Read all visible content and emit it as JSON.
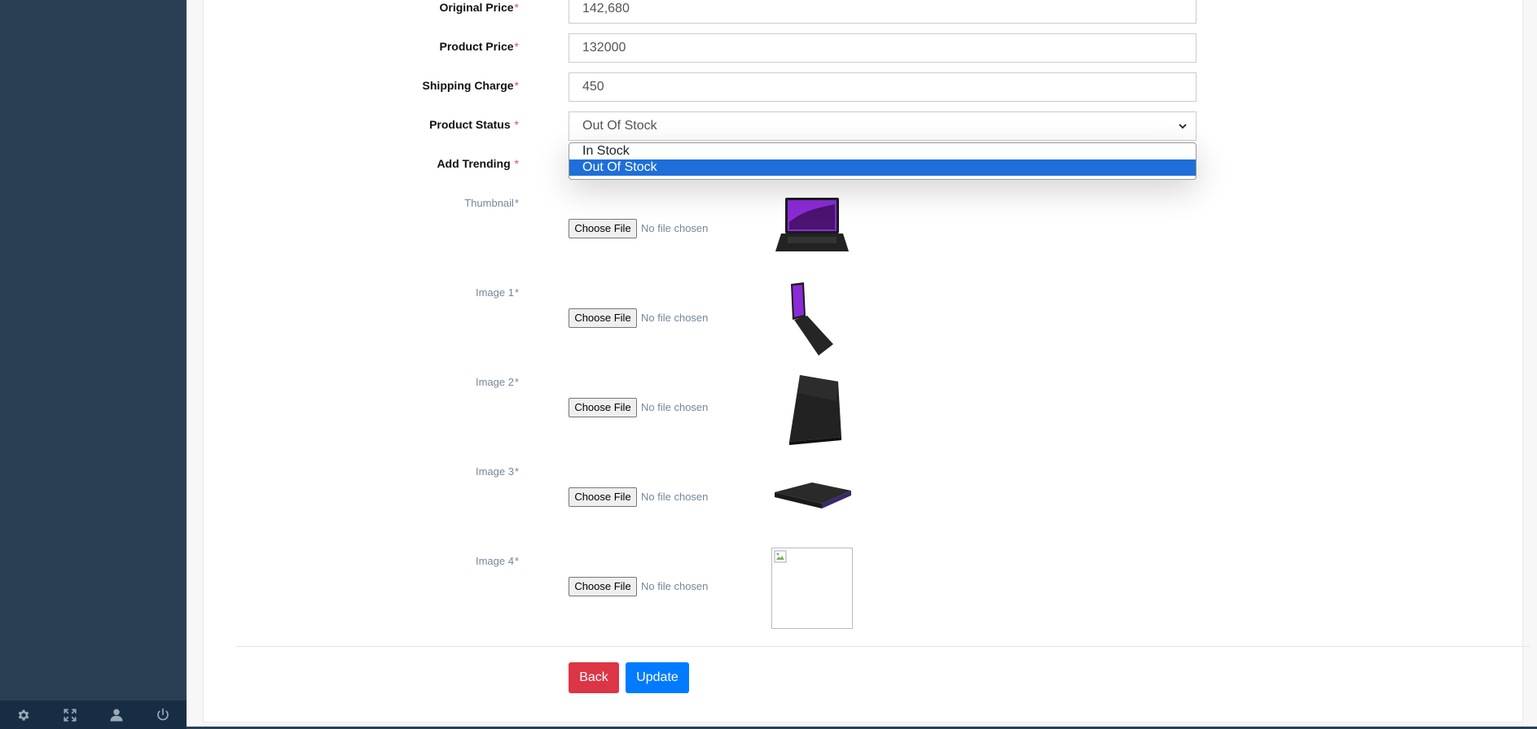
{
  "sidebar": {
    "footer_icons": [
      "gear-icon",
      "fullscreen-icon",
      "user-icon",
      "power-icon"
    ]
  },
  "form": {
    "original_price": {
      "label": "Original Price",
      "required": "*",
      "value": "142,680"
    },
    "product_price": {
      "label": "Product Price",
      "required": "*",
      "value": "132000"
    },
    "shipping_charge": {
      "label": "Shipping Charge",
      "required": "*",
      "value": "450"
    },
    "product_status": {
      "label": "Product Status ",
      "required": "*",
      "value": "Out Of Stock",
      "options": [
        "In Stock",
        "Out Of Stock"
      ],
      "selected_index": 1
    },
    "add_trending": {
      "label": "Add Trending ",
      "required": "*"
    },
    "uploads": [
      {
        "label": "Thumbnail",
        "required": "*",
        "button": "Choose File",
        "status": "No file chosen"
      },
      {
        "label": "Image 1",
        "required": "*",
        "button": "Choose File",
        "status": "No file chosen"
      },
      {
        "label": "Image 2",
        "required": "*",
        "button": "Choose File",
        "status": "No file chosen"
      },
      {
        "label": "Image 3",
        "required": "*",
        "button": "Choose File",
        "status": "No file chosen"
      },
      {
        "label": "Image 4",
        "required": "*",
        "button": "Choose File",
        "status": "No file chosen"
      }
    ]
  },
  "actions": {
    "back": "Back",
    "update": "Update"
  },
  "colors": {
    "sidebar": "#2a3f54",
    "danger": "#dc3545",
    "primary": "#007bff",
    "selected_option": "#1e6fd9"
  }
}
